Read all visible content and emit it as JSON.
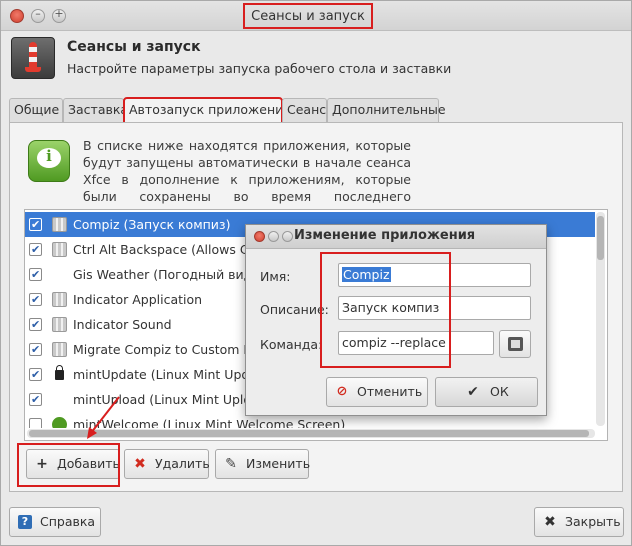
{
  "window": {
    "title": "Сеансы и запуск"
  },
  "header": {
    "title": "Сеансы и запуск",
    "subtitle": "Настройте параметры запуска рабочего стола и заставки",
    "icon": "rocket-icon"
  },
  "tabs": [
    {
      "label": "Общие"
    },
    {
      "label": "Заставка"
    },
    {
      "label": "Автозапуск приложений",
      "active": true
    },
    {
      "label": "Сеанс"
    },
    {
      "label": "Дополнительные"
    }
  ],
  "autostart": {
    "description": "В списке ниже находятся приложения, которые будут запущены автоматически в начале сеанса Xfce в дополнение к приложениям, которые были сохранены во время последнего завершения сеанса.",
    "items": [
      {
        "label": "Compiz (Запуск компиз)",
        "checked": true,
        "icon": "compiz-icon",
        "selected": true
      },
      {
        "label": "Ctrl Alt Backspace (Allows Ctrl+Alt+Backspace to restart the X server)",
        "checked": true,
        "icon": "compiz-icon"
      },
      {
        "label": "Gis Weather (Погодный виджет)",
        "checked": true,
        "icon": "none"
      },
      {
        "label": "Indicator Application",
        "checked": true,
        "icon": "compiz-icon"
      },
      {
        "label": "Indicator Sound",
        "checked": true,
        "icon": "compiz-icon"
      },
      {
        "label": "Migrate Compiz to Custom Profile",
        "checked": true,
        "icon": "compiz-icon"
      },
      {
        "label": "mintUpdate (Linux Mint Update Manager)",
        "checked": true,
        "icon": "lock-icon"
      },
      {
        "label": "mintUpload (Linux Mint Upload Manager)",
        "checked": true,
        "icon": "none"
      },
      {
        "label": "mintWelcome (Linux Mint Welcome Screen)",
        "checked": false,
        "icon": "info-icon"
      }
    ],
    "add_label": "Добавить",
    "remove_label": "Удалить",
    "edit_label": "Изменить"
  },
  "footer": {
    "help_label": "Справка",
    "close_label": "Закрыть"
  },
  "dialog": {
    "title": "Изменение приложения",
    "name_label": "Имя:",
    "name_value": "Compiz",
    "description_label": "Описание:",
    "description_value": "Запуск компиз",
    "command_label": "Команда:",
    "command_value": "compiz --replace",
    "cancel_label": "Отменить",
    "ok_label": "ОК"
  },
  "colors": {
    "highlight_red": "#d81e1e",
    "selection_blue": "#3a7bd5"
  }
}
